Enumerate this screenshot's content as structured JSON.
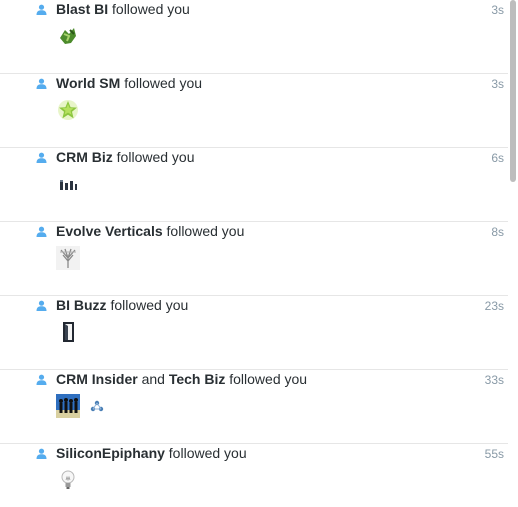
{
  "notifications": [
    {
      "name1": "Blast BI",
      "connector": "",
      "name2": "",
      "action": "followed you",
      "time": "3s",
      "avatar_icons": [
        "green-leaf-avatar-icon"
      ]
    },
    {
      "name1": "World SM",
      "connector": "",
      "name2": "",
      "action": "followed you",
      "time": "3s",
      "avatar_icons": [
        "green-star-avatar-icon"
      ]
    },
    {
      "name1": "CRM Biz",
      "connector": "",
      "name2": "",
      "action": "followed you",
      "time": "6s",
      "avatar_icons": [
        "bar-chart-avatar-icon"
      ]
    },
    {
      "name1": "Evolve Verticals",
      "connector": "",
      "name2": "",
      "action": "followed you",
      "time": "8s",
      "avatar_icons": [
        "branch-avatar-icon"
      ]
    },
    {
      "name1": "BI Buzz",
      "connector": "",
      "name2": "",
      "action": "followed you",
      "time": "23s",
      "avatar_icons": [
        "door-avatar-icon"
      ]
    },
    {
      "name1": "CRM Insider",
      "connector": "and",
      "name2": "Tech Biz",
      "action": "followed you",
      "time": "33s",
      "avatar_icons": [
        "silhouettes-avatar-icon",
        "network-avatar-icon"
      ]
    },
    {
      "name1": "SiliconEpiphany",
      "connector": "",
      "name2": "",
      "action": "followed you",
      "time": "55s",
      "avatar_icons": [
        "lightbulb-avatar-icon"
      ]
    }
  ],
  "colors": {
    "accent": "#55acee",
    "text": "#292f33",
    "muted": "#8899a6",
    "divider": "#e6e6e6"
  }
}
